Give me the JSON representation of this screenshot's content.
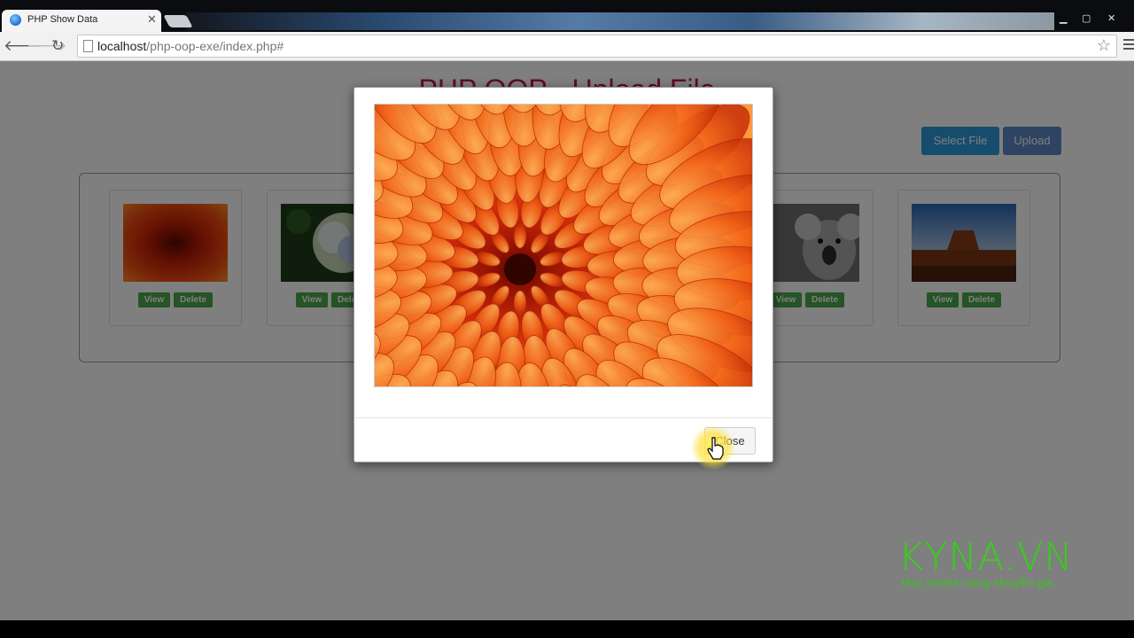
{
  "browser": {
    "tab_title": "PHP Show Data",
    "tab_close": "✕",
    "url_host": "localhost",
    "url_path": "/php-oop-exe/index.php#"
  },
  "page": {
    "title": "PHP OOP - Upload File",
    "select_button": "Select File",
    "upload_button": "Upload",
    "cards": [
      {
        "image": "chrysanthemum-image",
        "view": "View",
        "delete": "Delete"
      },
      {
        "image": "hydrangea-image",
        "view": "View",
        "delete": "Delete"
      },
      {
        "image": "koala-image",
        "view": "View",
        "delete": "Delete"
      },
      {
        "image": "desert-image",
        "view": "View",
        "delete": "Delete"
      }
    ]
  },
  "modal": {
    "image": "chrysanthemum-image",
    "close_label": "Close"
  },
  "watermark": {
    "brand": "KYNA.VN",
    "tagline": "Học online cùng chuyên gia"
  },
  "colors": {
    "title": "#c0155c",
    "primary_button": "#2c9ad8",
    "success_button": "#4aa94a",
    "brand": "#35d018"
  },
  "icons": [
    "back-icon",
    "forward-icon",
    "reload-icon",
    "page-icon",
    "star-icon",
    "menu-icon",
    "close-icon",
    "cursor-icon"
  ]
}
